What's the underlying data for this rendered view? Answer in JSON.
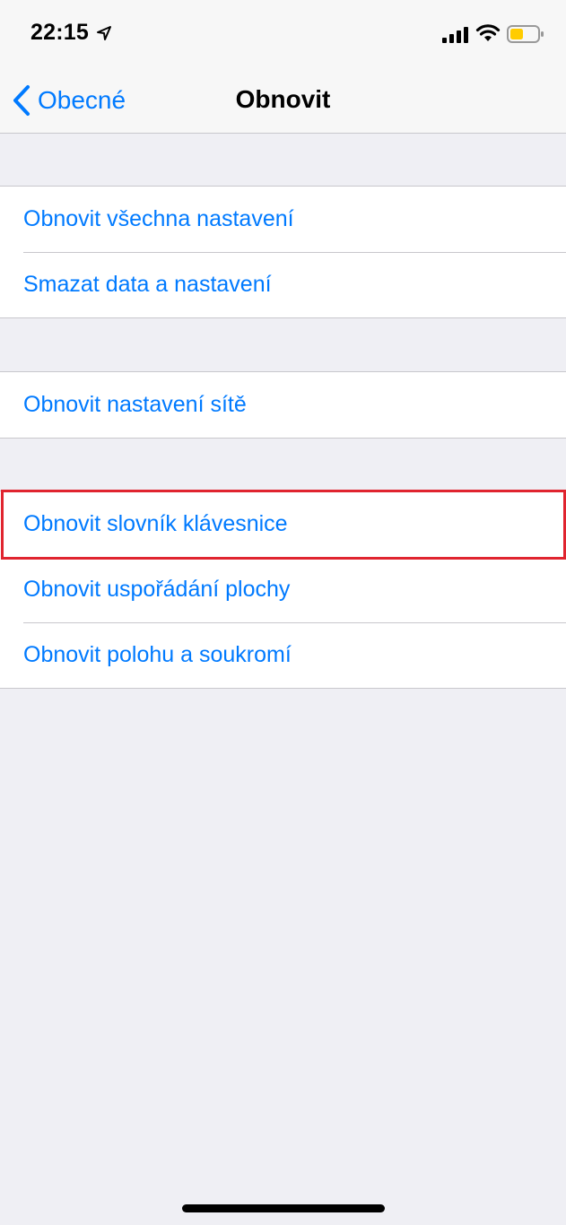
{
  "status_bar": {
    "time": "22:15",
    "icons": [
      "location-arrow-icon",
      "cellular-signal-icon",
      "wifi-icon",
      "battery-icon"
    ],
    "battery_color": "#ffcc00"
  },
  "nav": {
    "back_label": "Obecné",
    "title": "Obnovit"
  },
  "groups": [
    {
      "items": [
        {
          "label": "Obnovit všechna nastavení"
        },
        {
          "label": "Smazat data a nastavení"
        }
      ]
    },
    {
      "items": [
        {
          "label": "Obnovit nastavení sítě"
        }
      ]
    },
    {
      "items": [
        {
          "label": "Obnovit slovník klávesnice",
          "highlighted": true
        },
        {
          "label": "Obnovit uspořádání plochy"
        },
        {
          "label": "Obnovit polohu a soukromí"
        }
      ]
    }
  ],
  "colors": {
    "accent": "#007aff",
    "highlight": "#e0242f",
    "background": "#efeff4"
  }
}
